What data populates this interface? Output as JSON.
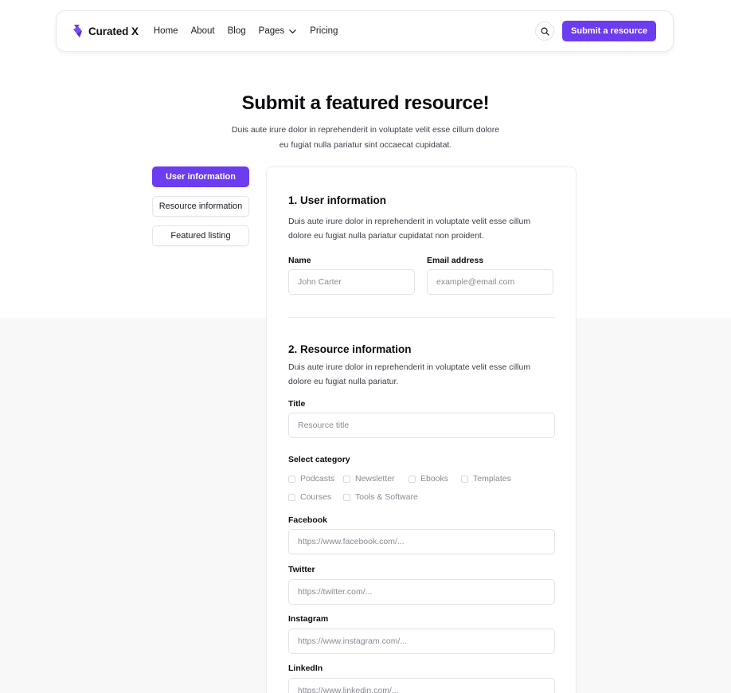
{
  "brand": {
    "name": "Curated X",
    "logo_icon": "brand-logo-icon"
  },
  "nav": {
    "links": [
      "Home",
      "About",
      "Blog",
      "Pages",
      "Pricing"
    ],
    "cta": "Submit a resource",
    "search_icon": "search-icon"
  },
  "hero": {
    "title": "Submit a featured resource!",
    "subtitle_line1": "Duis aute irure dolor in reprehenderit in voluptate velit esse cillum dolore",
    "subtitle_line2": "eu fugiat nulla pariatur sint occaecat cupidatat."
  },
  "steps": [
    {
      "label": "User information",
      "active": true
    },
    {
      "label": "Resource information",
      "active": false
    },
    {
      "label": "Featured listing",
      "active": false
    }
  ],
  "user_section": {
    "title": "1. User information",
    "desc_line1": "Duis aute irure dolor in reprehenderit in voluptate velit esse cillum",
    "desc_line2": "dolore eu fugiat nulla pariatur cupidatat non proident.",
    "name_label": "Name",
    "name_placeholder": "John Carter",
    "email_label": "Email address",
    "email_placeholder": "example@email.com"
  },
  "resource_section": {
    "title": "2. Resource information",
    "desc_line1": "Duis aute irure dolor in reprehenderit in voluptate velit esse cillum",
    "desc_line2": "dolore eu fugiat nulla pariatur.",
    "title_label": "Title",
    "title_placeholder": "Resource title",
    "category_label": "Select category",
    "categories": [
      "Podcasts",
      "Newsletter",
      "Ebooks",
      "Templates",
      "Courses",
      "Tools & Software"
    ],
    "facebook_label": "Facebook",
    "facebook_placeholder": "https://www.facebook.com/...",
    "twitter_label": "Twitter",
    "twitter_placeholder": "https://twitter.com/...",
    "instagram_label": "Instagram",
    "instagram_placeholder": "https://www.instagram.com/...",
    "linkedin_label": "LinkedIn",
    "linkedin_placeholder": "https://www.linkedin.com/..."
  },
  "colors": {
    "accent": "#6c3cf0",
    "page_gray": "#f8f8f9",
    "border": "#e2e2e8"
  }
}
